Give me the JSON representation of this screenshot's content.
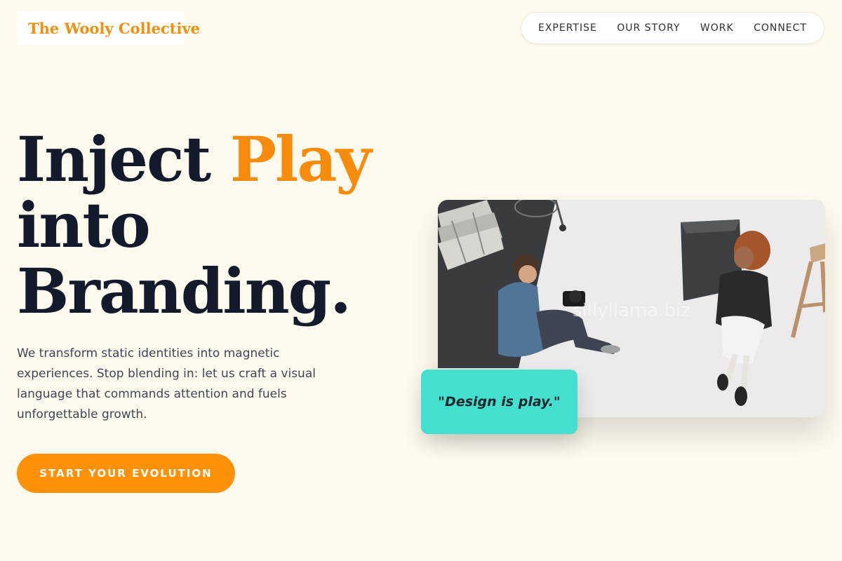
{
  "brand": {
    "name": "The Wooly Collective",
    "accent": "#f78c0c"
  },
  "nav": {
    "items": [
      {
        "label": "EXPERTISE"
      },
      {
        "label": "OUR STORY"
      },
      {
        "label": "WORK"
      },
      {
        "label": "CONNECT"
      }
    ]
  },
  "hero": {
    "headline": {
      "line1_prefix": "Inject ",
      "line1_accent": "Play",
      "line2": "into",
      "line3": "Branding."
    },
    "description": "We transform static identities into magnetic experiences. Stop blending in: let us craft a visual language that commands attention and fuels unforgettable growth.",
    "cta_label": "START YOUR EVOLUTION",
    "cta_color": "#ff9109"
  },
  "photo": {
    "watermark": "sillyllama.biz",
    "quote": "\"Design is play.\"",
    "quote_color": "#43e0d0"
  }
}
